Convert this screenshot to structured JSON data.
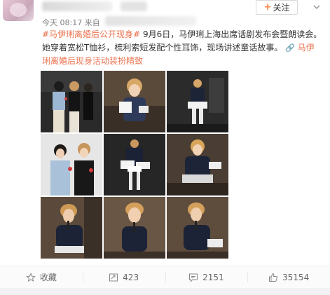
{
  "header": {
    "timestamp": "今天 08:17",
    "source_prefix": "来自",
    "follow_label": "关注"
  },
  "post": {
    "topic_tag": "#马伊琍离婚后公开现身#",
    "text_1": " 9月6日，马伊琍上海出席话剧发布会暨朗读会。她穿着宽松T恤衫，梳利索短发配个性耳饰，现场讲述童话故事。",
    "link_label": "马伊琍离婚后现身活动装扮精致"
  },
  "photos": [
    {
      "name": "photo-1",
      "scene": "two-women-standing-with-flowers"
    },
    {
      "name": "photo-2",
      "scene": "woman-seated-reading"
    },
    {
      "name": "photo-3",
      "scene": "woman-seated-stage"
    },
    {
      "name": "photo-4",
      "scene": "two-women-closeup-flowers"
    },
    {
      "name": "photo-5",
      "scene": "woman-standing-mic"
    },
    {
      "name": "photo-6",
      "scene": "woman-seated-blonde-mic"
    },
    {
      "name": "photo-7",
      "scene": "woman-closeup-mic"
    },
    {
      "name": "photo-8",
      "scene": "woman-closeup-mic-2"
    },
    {
      "name": "photo-9",
      "scene": "woman-closeup-mic-3"
    }
  ],
  "actions": {
    "favorite_label": "收藏",
    "repost_count": "423",
    "comment_count": "2151",
    "like_count": "35154"
  },
  "colors": {
    "accent": "#eb7350",
    "follow_plus": "#ff8140"
  }
}
